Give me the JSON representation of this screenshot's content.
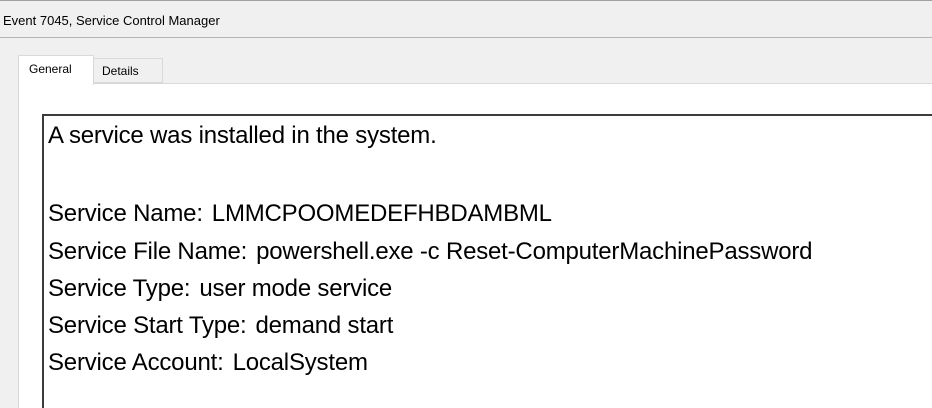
{
  "window": {
    "title": "Event 7045, Service Control Manager"
  },
  "tabs": [
    {
      "label": "General",
      "selected": true
    },
    {
      "label": "Details",
      "selected": false
    }
  ],
  "event": {
    "description": "A service was installed in the system.",
    "fields": [
      {
        "label": "Service Name:",
        "value": "LMMCPOOMEDEFHBDAMBML"
      },
      {
        "label": "Service File Name:",
        "value": "powershell.exe -c Reset-ComputerMachinePassword"
      },
      {
        "label": "Service Type:",
        "value": "user mode service"
      },
      {
        "label": "Service Start Type:",
        "value": "demand start"
      },
      {
        "label": "Service Account:",
        "value": "LocalSystem"
      }
    ]
  }
}
